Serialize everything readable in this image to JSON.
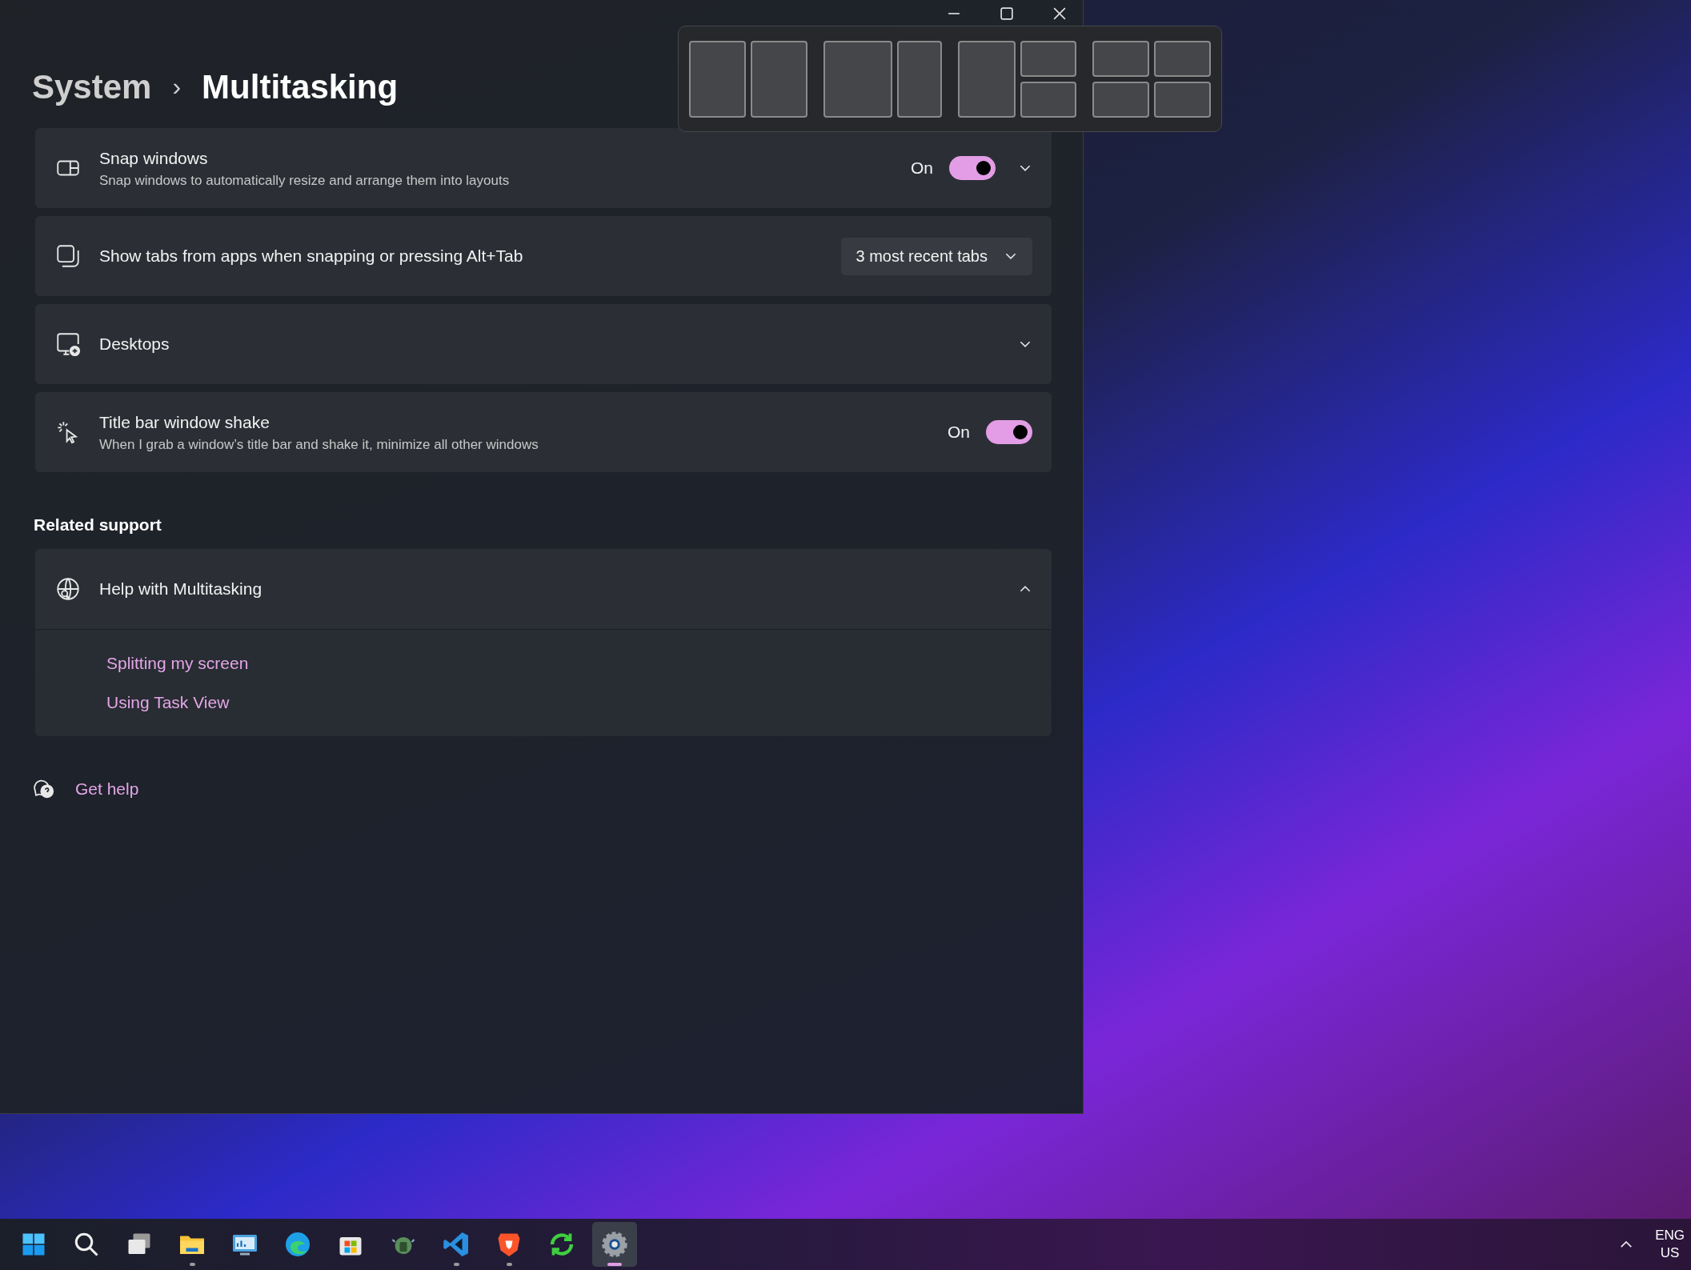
{
  "breadcrumb": {
    "parent": "System",
    "separator": "›",
    "current": "Multitasking"
  },
  "settings": [
    {
      "kind": "toggle",
      "title": "Snap windows",
      "description": "Snap windows to automatically resize and arrange them into layouts",
      "state_label": "On",
      "on": true,
      "expanded": false
    },
    {
      "kind": "dropdown",
      "title": "Show tabs from apps when snapping or pressing Alt+Tab",
      "value": "3 most recent tabs"
    },
    {
      "kind": "expander",
      "title": "Desktops",
      "expanded": false
    },
    {
      "kind": "toggle",
      "title": "Title bar window shake",
      "description": "When I grab a window’s title bar and shake it, minimize all other windows",
      "state_label": "On",
      "on": true
    }
  ],
  "related_support": {
    "heading": "Related support",
    "title": "Help with Multitasking",
    "expanded": true,
    "links": [
      "Splitting my screen",
      "Using Task View"
    ]
  },
  "get_help": "Get help",
  "snap_layouts": [
    {
      "kind": "halves"
    },
    {
      "kind": "wide-narrow"
    },
    {
      "kind": "left-stacked"
    },
    {
      "kind": "quadrants"
    }
  ],
  "taskbar": {
    "apps": [
      {
        "kind": "start",
        "running": false,
        "selected": false
      },
      {
        "kind": "search",
        "running": false,
        "selected": false
      },
      {
        "kind": "taskview",
        "running": false,
        "selected": false
      },
      {
        "kind": "folder",
        "running": true,
        "selected": false
      },
      {
        "kind": "panel",
        "running": false,
        "selected": false
      },
      {
        "kind": "browser",
        "running": false,
        "selected": false
      },
      {
        "kind": "store",
        "running": false,
        "selected": false
      },
      {
        "kind": "robot",
        "running": false,
        "selected": false
      },
      {
        "kind": "code",
        "running": true,
        "selected": false
      },
      {
        "kind": "shield",
        "running": true,
        "selected": false
      },
      {
        "kind": "sync",
        "running": false,
        "selected": false
      },
      {
        "kind": "settings",
        "running": true,
        "selected": true
      }
    ],
    "language": [
      "ENG",
      "US"
    ]
  }
}
